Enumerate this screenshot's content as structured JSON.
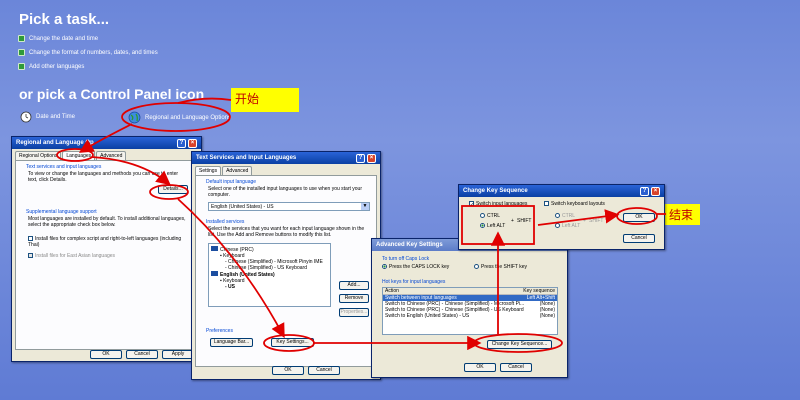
{
  "control_panel": {
    "pick_task": "Pick a task...",
    "tasks": [
      "Change the date and time",
      "Change the format of numbers, dates, and times",
      "Add other languages"
    ],
    "or_pick": "or pick a Control Panel icon",
    "icons": [
      "Date and Time",
      "Regional and Language Options"
    ]
  },
  "annotations": {
    "start": "开始",
    "end": "结束"
  },
  "regional_dialog": {
    "title": "Regional and Language Op",
    "tabs": [
      "Regional Options",
      "Languages",
      "Advanced"
    ],
    "text_services_label": "Text services and input languages",
    "text_services_desc": "To view or change the languages and methods you can use to enter text, click Details.",
    "details_button": "Details...",
    "supplemental_label": "Supplemental language support",
    "supplemental_desc": "Most languages are installed by default. To install additional languages, select the appropriate check box below.",
    "complex_script": "Install files for complex script and right-to-left languages (including Thai)",
    "east_asian": "Install files for East Asian languages",
    "ok": "OK",
    "cancel": "Cancel",
    "apply": "Apply"
  },
  "text_services_dialog": {
    "title": "Text Services and Input Languages",
    "tabs": [
      "Settings",
      "Advanced"
    ],
    "default_label": "Default input language",
    "default_desc": "Select one of the installed input languages to use when you start your computer.",
    "default_value": "English (United States) - US",
    "installed_label": "Installed services",
    "installed_desc": "Select the services that you want for each input language shown in the list. Use the Add and Remove buttons to modify this list.",
    "services": [
      "Chinese (PRC)",
      "Keyboard",
      "- Chinese (Simplified) - Microsoft Pinyin IME",
      "- Chinese (Simplified) - US Keyboard",
      "English (United States)",
      "Keyboard",
      "- US"
    ],
    "add": "Add...",
    "remove": "Remove",
    "properties": "Properties...",
    "preferences_label": "Preferences",
    "language_bar": "Language Bar...",
    "key_settings": "Key Settings...",
    "ok": "OK",
    "cancel": "Cancel"
  },
  "advanced_key_dialog": {
    "title": "Advanced Key Settings",
    "caps_label": "To turn off Caps Lock",
    "press_caps": "Press the CAPS LOCK key",
    "press_shift": "Press the SHIFT key",
    "hotkeys_label": "Hot keys for input languages",
    "col_action": "Action",
    "col_key": "Key sequence",
    "rows": [
      [
        "Switch between input languages",
        "Left Alt+Shift"
      ],
      [
        "Switch to Chinese (PRC) - Chinese (Simplified) - Microsoft Pi...",
        "(None)"
      ],
      [
        "Switch to Chinese (PRC) - Chinese (Simplified) - US Keyboard",
        "(None)"
      ],
      [
        "Switch to English (United States) - US",
        "(None)"
      ]
    ],
    "change_key": "Change Key Sequence...",
    "ok": "OK",
    "cancel": "Cancel"
  },
  "change_key_dialog": {
    "title": "Change Key Sequence",
    "switch_input": "Switch input languages",
    "switch_layouts": "Switch keyboard layouts",
    "ctrl": "CTRL",
    "left_alt": "Left ALT",
    "shift": "SHIFT",
    "plus": "+",
    "ok": "OK",
    "cancel": "Cancel"
  }
}
